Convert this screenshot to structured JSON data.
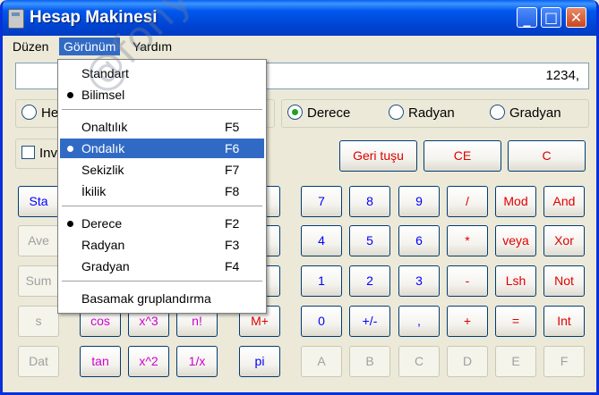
{
  "window": {
    "title": "Hesap Makinesi"
  },
  "menubar": [
    {
      "label": "Düzen"
    },
    {
      "label": "Görünüm"
    },
    {
      "label": "Yardım"
    }
  ],
  "display": {
    "value": "1234,"
  },
  "radix": {
    "hex": "He",
    "dec": "",
    "oct": "",
    "bin": ""
  },
  "angle": {
    "degree": "Derece",
    "radian": "Radyan",
    "grad": "Gradyan"
  },
  "inv": {
    "label": "Inv"
  },
  "top_buttons": {
    "back": "Geri tuşu",
    "ce": "CE",
    "c": "C"
  },
  "stat_buttons": [
    "Sta",
    "Ave",
    "Sum",
    "s",
    "Dat"
  ],
  "fn_buttons": {
    "cos": "cos",
    "x3": "x^3",
    "fact": "n!",
    "tan": "tan",
    "x2": "x^2",
    "inv": "1/x"
  },
  "mem_buttons": {
    "mplus": "M+",
    "pi": "pi"
  },
  "digits": [
    "7",
    "8",
    "9",
    "4",
    "5",
    "6",
    "1",
    "2",
    "3",
    "0",
    "+/-",
    ","
  ],
  "ops": [
    "/",
    "*",
    "-",
    "+",
    "="
  ],
  "logic": [
    "Mod",
    "And",
    "veya",
    "Xor",
    "Lsh",
    "Not",
    "Int"
  ],
  "hex_digits": [
    "A",
    "B",
    "C",
    "D",
    "E",
    "F"
  ],
  "view_menu": {
    "items": [
      {
        "label": "Standart",
        "shortcut": "",
        "checked": false
      },
      {
        "label": "Bilimsel",
        "shortcut": "",
        "checked": true
      },
      {
        "label": "Onaltılık",
        "shortcut": "F5",
        "checked": false
      },
      {
        "label": "Ondalık",
        "shortcut": "F6",
        "checked": true,
        "highlighted": true
      },
      {
        "label": "Sekizlik",
        "shortcut": "F7",
        "checked": false
      },
      {
        "label": "İkilik",
        "shortcut": "F8",
        "checked": false
      },
      {
        "label": "Derece",
        "shortcut": "F2",
        "checked": true
      },
      {
        "label": "Radyan",
        "shortcut": "F3",
        "checked": false
      },
      {
        "label": "Gradyan",
        "shortcut": "F4",
        "checked": false
      },
      {
        "label": "Basamak gruplandırma",
        "shortcut": "",
        "checked": false
      }
    ]
  },
  "watermark": "@fonyr.dvbcat.org",
  "colors": {
    "titlebar": "#0054e3",
    "highlight": "#316ac5",
    "red": "#e00000",
    "blue": "#0000ff",
    "magenta": "#d000d0"
  }
}
